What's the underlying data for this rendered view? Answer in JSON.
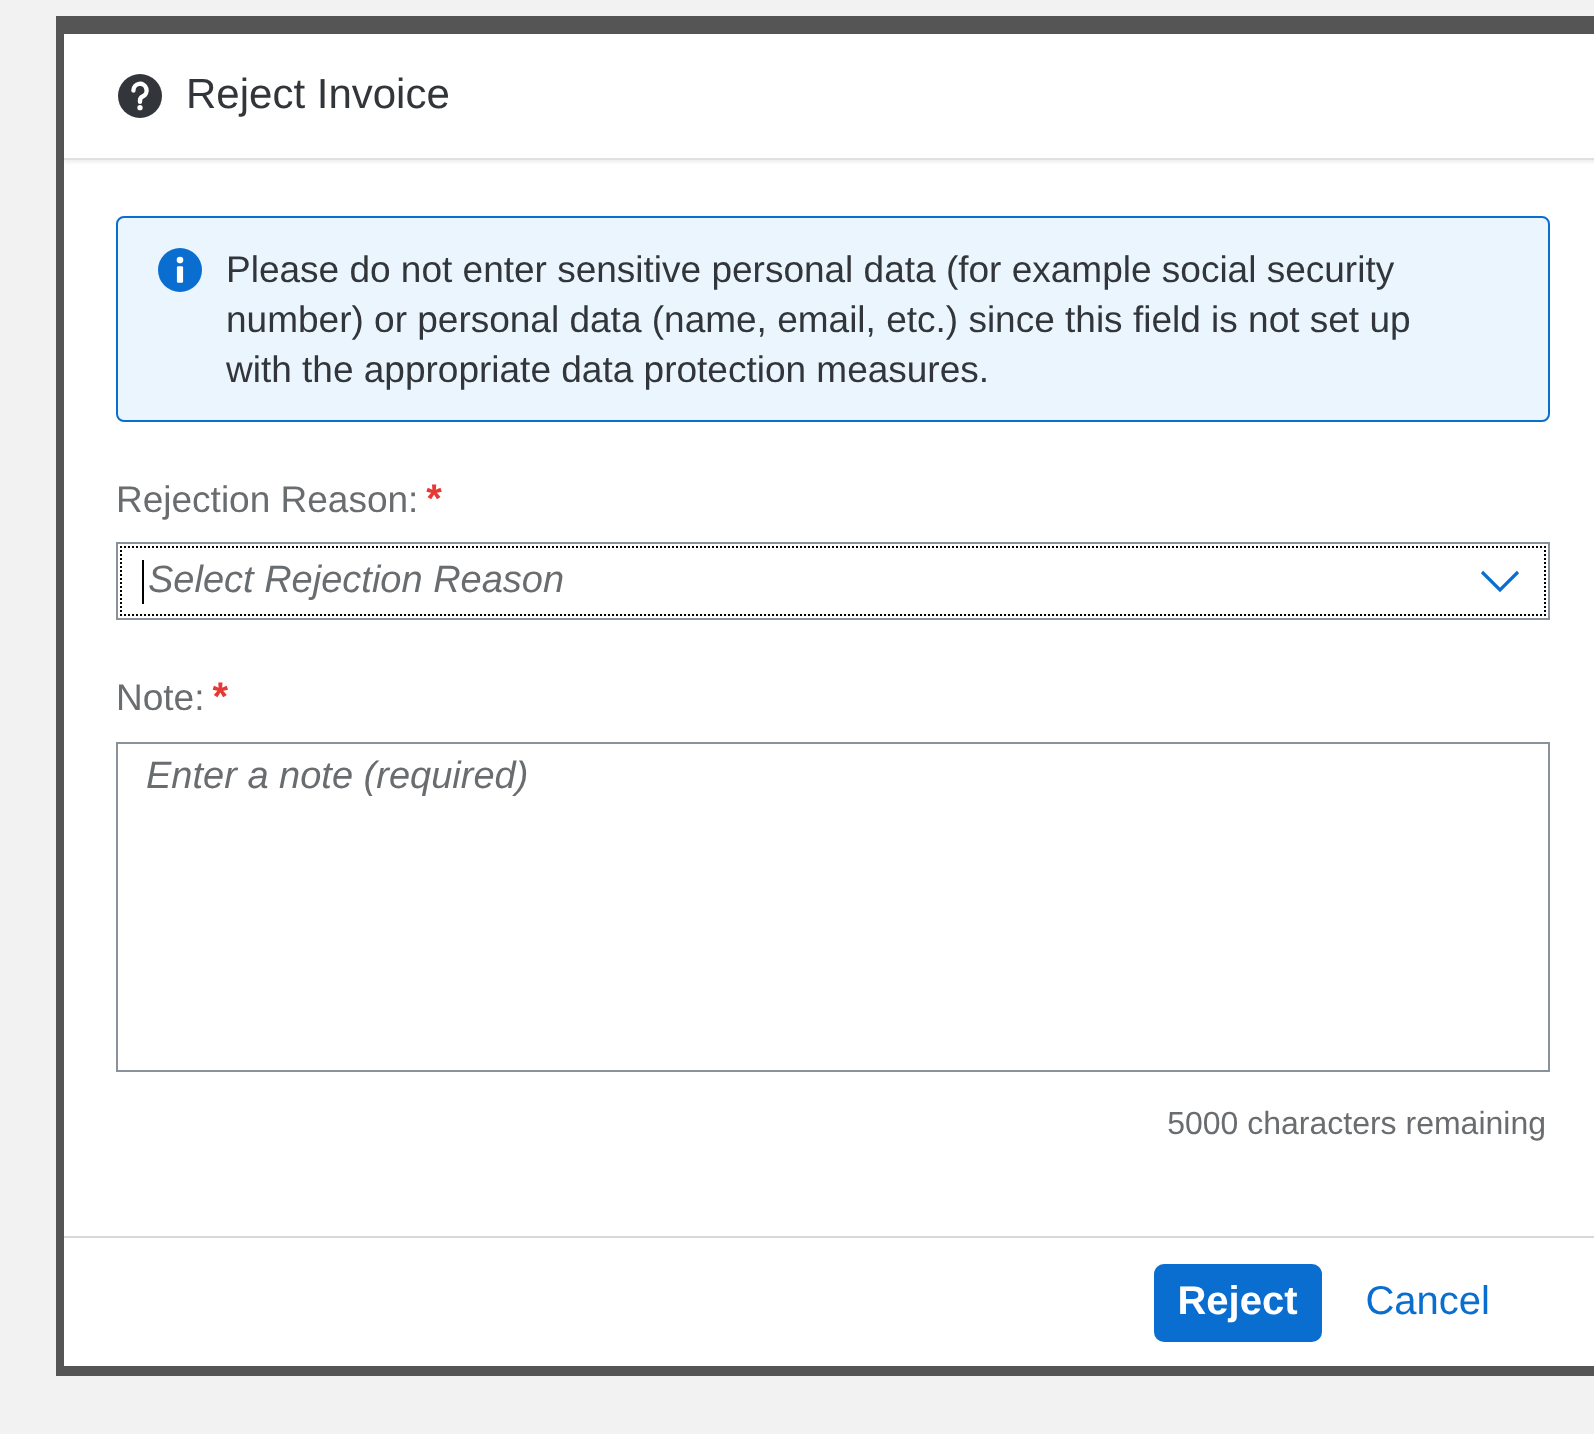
{
  "dialog": {
    "title": "Reject Invoice",
    "info_message": "Please do not enter sensitive personal data (for example social security number) or personal data (name, email, etc.) since this field is not set up with the appropriate data protection measures.",
    "fields": [
      {
        "kind": "select",
        "label": "Rejection Reason:",
        "required_mark": "*",
        "placeholder": "Select Rejection Reason",
        "focused": true
      },
      {
        "kind": "textarea",
        "label": "Note:",
        "required_mark": "*",
        "placeholder": "Enter a note (required)",
        "focused": false
      }
    ],
    "counter": "5000 characters remaining",
    "buttons": [
      {
        "label": "Reject",
        "primary": true
      },
      {
        "label": "Cancel",
        "primary": false
      }
    ]
  }
}
